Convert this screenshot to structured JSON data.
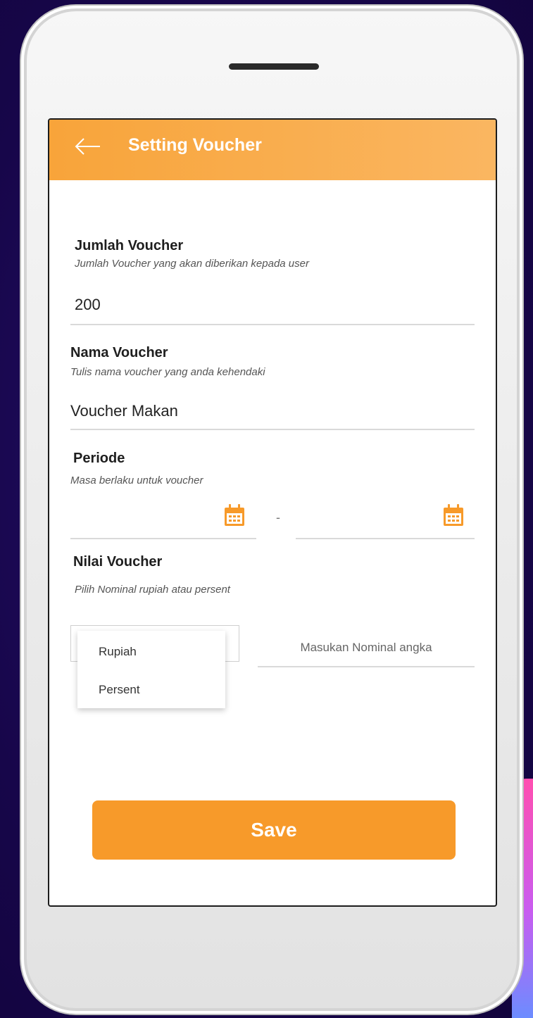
{
  "header": {
    "title": "Setting Voucher",
    "back_icon": "arrow-left-icon",
    "gradient": [
      "#f8a43a",
      "#fab661"
    ]
  },
  "form": {
    "jumlah": {
      "label": "Jumlah Voucher",
      "hint": "Jumlah Voucher yang akan diberikan kepada user",
      "value": "200"
    },
    "nama": {
      "label": "Nama Voucher",
      "hint": "Tulis nama voucher yang anda kehendaki",
      "value": "Voucher Makan"
    },
    "periode": {
      "label": "Periode",
      "hint": "Masa berlaku untuk voucher",
      "separator": "-",
      "start_icon": "calendar-icon",
      "end_icon": "calendar-icon"
    },
    "nilai": {
      "label": "Nilai  Voucher",
      "hint": "Pilih Nominal rupiah atau persent",
      "options": [
        "Rupiah",
        "Persent"
      ],
      "nominal_placeholder": "Masukan Nominal angka"
    }
  },
  "actions": {
    "save_label": "Save"
  },
  "colors": {
    "accent": "#f79a2a",
    "background": "#17064a"
  }
}
